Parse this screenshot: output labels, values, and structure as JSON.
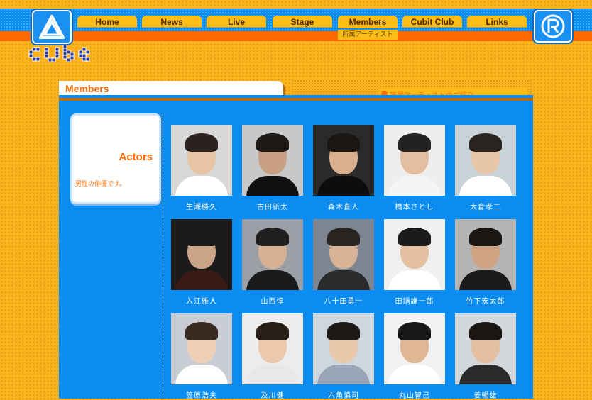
{
  "nav": {
    "tabs": [
      {
        "label": "Home"
      },
      {
        "label": "News"
      },
      {
        "label": "Live"
      },
      {
        "label": "Stage"
      },
      {
        "label": "Members"
      },
      {
        "label": "Cubit Club"
      },
      {
        "label": "Links"
      }
    ],
    "active_sub": "所属アーティスト"
  },
  "header": {
    "title": "Members",
    "subtitle": "所属アーティストのご紹介"
  },
  "sidebar": {
    "category": "Actors",
    "description": "男性の俳優です。"
  },
  "members": [
    {
      "name": "生瀬勝久"
    },
    {
      "name": "古田新太"
    },
    {
      "name": "森木直人"
    },
    {
      "name": "橋本さとし"
    },
    {
      "name": "大倉孝二"
    },
    {
      "name": "入江雅人"
    },
    {
      "name": "山西惇"
    },
    {
      "name": "八十田勇一"
    },
    {
      "name": "田鍋謙一郎"
    },
    {
      "name": "竹下宏太郎"
    },
    {
      "name": "笠原浩夫"
    },
    {
      "name": "及川健"
    },
    {
      "name": "六角慎司"
    },
    {
      "name": "丸山智己"
    },
    {
      "name": "姜暢雄"
    }
  ],
  "colors": {
    "accent_orange": "#ff6a00",
    "panel_blue": "#0a8cf0",
    "tab_yellow": "#fbbd16"
  }
}
